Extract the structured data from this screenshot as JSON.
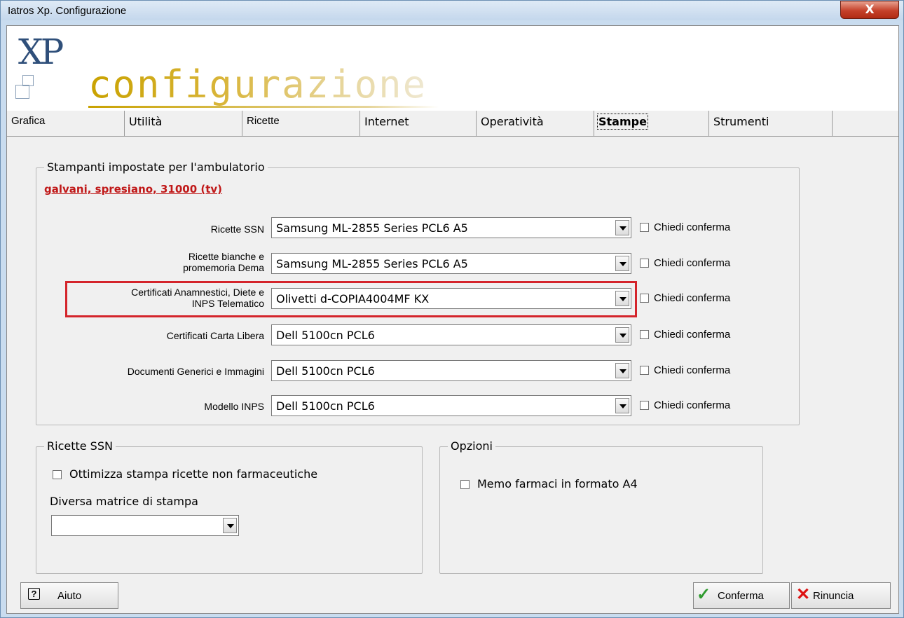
{
  "window": {
    "title": "Iatros Xp. Configurazione",
    "close_glyph": "X"
  },
  "banner": {
    "logo_text": "XP",
    "heading": "configurazione"
  },
  "tabs": [
    {
      "label": "Grafica"
    },
    {
      "label": "Utilità"
    },
    {
      "label": "Ricette"
    },
    {
      "label": "Internet"
    },
    {
      "label": "Operatività"
    },
    {
      "label": "Stampe",
      "selected": true
    },
    {
      "label": "Strumenti"
    }
  ],
  "printers_group": {
    "legend": "Stampanti impostate per l'ambulatorio",
    "location_link": "galvani, spresiano, 31000 (tv)",
    "rows": [
      {
        "label": "Ricette SSN",
        "printer": "Samsung ML-2855 Series PCL6 A5",
        "confirm_label": "Chiedi conferma",
        "confirm": false
      },
      {
        "label": "Ricette bianche e promemoria Dema",
        "printer": "Samsung ML-2855 Series PCL6 A5",
        "confirm_label": "Chiedi conferma",
        "confirm": false
      },
      {
        "label": "Certificati Anamnestici, Diete e INPS Telematico",
        "printer": "Olivetti d-COPIA4004MF KX",
        "confirm_label": "Chiedi conferma",
        "confirm": false
      },
      {
        "label": "Certificati Carta Libera",
        "printer": "Dell 5100cn PCL6",
        "confirm_label": "Chiedi conferma",
        "confirm": false
      },
      {
        "label": "Documenti Generici e Immagini",
        "printer": "Dell 5100cn PCL6",
        "confirm_label": "Chiedi conferma",
        "confirm": false
      },
      {
        "label": "Modello INPS",
        "printer": "Dell 5100cn PCL6",
        "confirm_label": "Chiedi conferma",
        "confirm": false
      }
    ]
  },
  "ricette_group": {
    "legend": "Ricette SSN",
    "optimize_label": "Ottimizza stampa ricette non farmaceutiche",
    "matrix_label": "Diversa matrice di stampa",
    "matrix_value": ""
  },
  "options_group": {
    "legend": "Opzioni",
    "memo_label": "Memo farmaci in formato A4"
  },
  "footer": {
    "help": "Aiuto",
    "confirm": "Conferma",
    "cancel": "Rinuncia"
  },
  "colors": {
    "highlight_border": "#d4242b",
    "link": "#c01818",
    "title_gold": "#c9a200"
  }
}
